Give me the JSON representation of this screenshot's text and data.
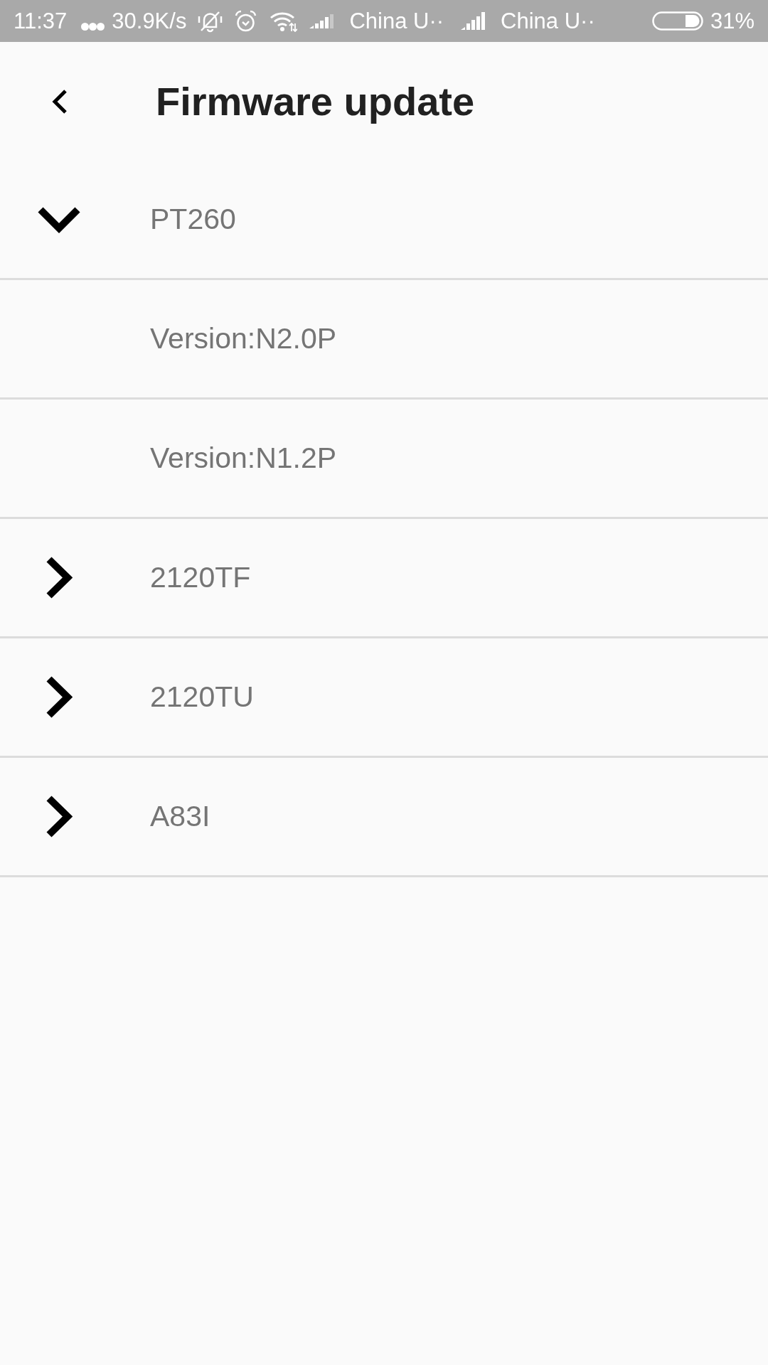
{
  "status_bar": {
    "time": "11:37",
    "network_speed": "30.9K/s",
    "carrier_1": "China U··",
    "carrier_2": "China U··",
    "battery": "31%"
  },
  "header": {
    "title": "Firmware update"
  },
  "devices": [
    {
      "label": "PT260",
      "expanded": true,
      "children": [
        {
          "label": "Version:N2.0P"
        },
        {
          "label": "Version:N1.2P"
        }
      ]
    },
    {
      "label": "2120TF",
      "expanded": false
    },
    {
      "label": "2120TU",
      "expanded": false
    },
    {
      "label": "A83I",
      "expanded": false
    }
  ]
}
